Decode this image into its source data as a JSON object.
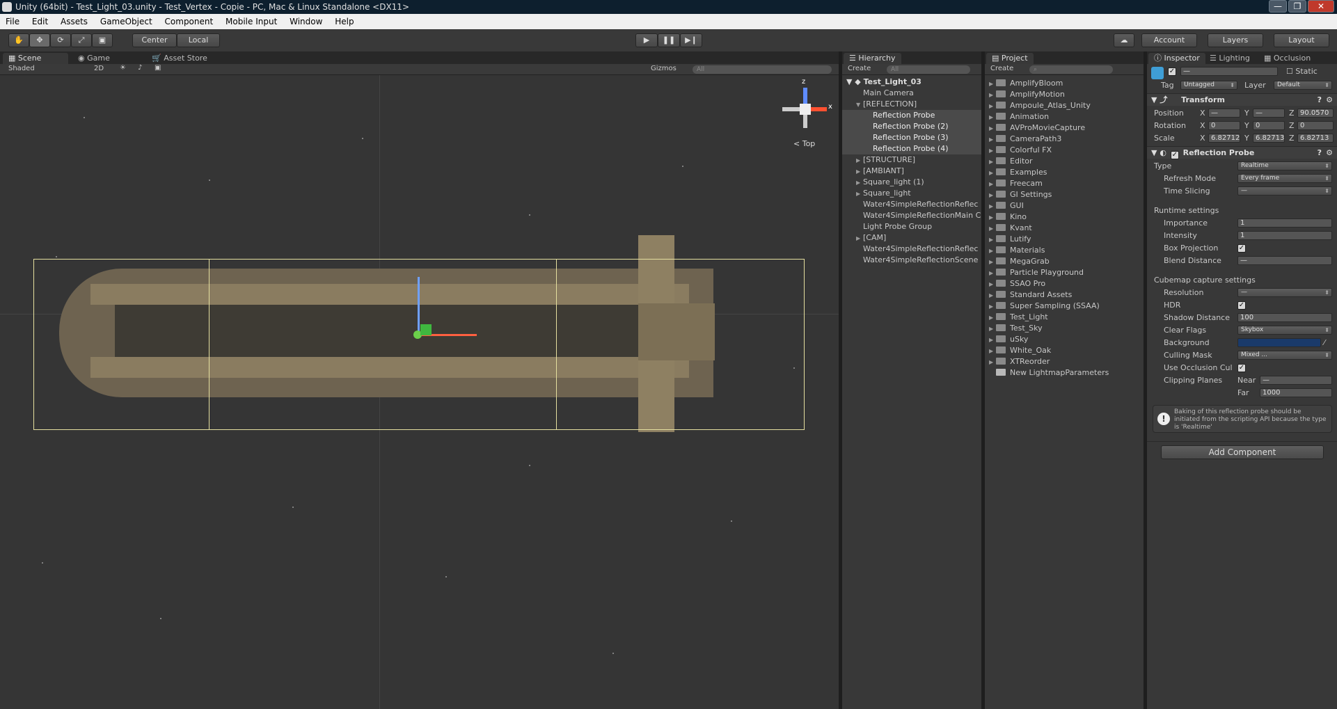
{
  "window": {
    "title": "Unity (64bit) - Test_Light_03.unity - Test_Vertex - Copie - PC, Mac & Linux Standalone <DX11>",
    "min": "—",
    "max": "❐",
    "close": "✕"
  },
  "menu": [
    "File",
    "Edit",
    "Assets",
    "GameObject",
    "Component",
    "Mobile Input",
    "Window",
    "Help"
  ],
  "toolbar": {
    "pivot": "Center",
    "space": "Local",
    "account": "Account",
    "layers": "Layers",
    "layout": "Layout"
  },
  "scene": {
    "tabs": {
      "scene": "Scene",
      "game": "Game",
      "asset_store": "Asset Store"
    },
    "shading": "Shaded",
    "mode2d": "2D",
    "gizmos": "Gizmos",
    "search_placeholder": "All",
    "view_label": "Top",
    "axis_x": "x",
    "axis_z": "z"
  },
  "hierarchy": {
    "tab": "Hierarchy",
    "create": "Create",
    "search_placeholder": "All",
    "scene_name": "Test_Light_03",
    "items": [
      {
        "label": "Main Camera",
        "indent": 1,
        "arrow": "",
        "selected": false
      },
      {
        "label": "[REFLECTION]",
        "indent": 1,
        "arrow": "▼",
        "selected": false
      },
      {
        "label": "Reflection Probe",
        "indent": 2,
        "arrow": "",
        "selected": true
      },
      {
        "label": "Reflection Probe (2)",
        "indent": 2,
        "arrow": "",
        "selected": true
      },
      {
        "label": "Reflection Probe (3)",
        "indent": 2,
        "arrow": "",
        "selected": true
      },
      {
        "label": "Reflection Probe (4)",
        "indent": 2,
        "arrow": "",
        "selected": true
      },
      {
        "label": "[STRUCTURE]",
        "indent": 1,
        "arrow": "▶",
        "selected": false
      },
      {
        "label": "[AMBIANT]",
        "indent": 1,
        "arrow": "▶",
        "selected": false
      },
      {
        "label": "Square_light (1)",
        "indent": 1,
        "arrow": "▶",
        "selected": false
      },
      {
        "label": "Square_light",
        "indent": 1,
        "arrow": "▶",
        "selected": false
      },
      {
        "label": "Water4SimpleReflectionReflec",
        "indent": 1,
        "arrow": "",
        "selected": false
      },
      {
        "label": "Water4SimpleReflectionMain C",
        "indent": 1,
        "arrow": "",
        "selected": false
      },
      {
        "label": "Light Probe Group",
        "indent": 1,
        "arrow": "",
        "selected": false
      },
      {
        "label": "[CAM]",
        "indent": 1,
        "arrow": "▶",
        "selected": false
      },
      {
        "label": "Water4SimpleReflectionReflec",
        "indent": 1,
        "arrow": "",
        "selected": false
      },
      {
        "label": "Water4SimpleReflectionScene",
        "indent": 1,
        "arrow": "",
        "selected": false
      }
    ]
  },
  "project": {
    "tab": "Project",
    "create": "Create",
    "items": [
      "AmplifyBloom",
      "AmplifyMotion",
      "Ampoule_Atlas_Unity",
      "Animation",
      "AVProMovieCapture",
      "CameraPath3",
      "Colorful FX",
      "Editor",
      "Examples",
      "Freecam",
      "GI Settings",
      "GUI",
      "Kino",
      "Kvant",
      "Lutify",
      "Materials",
      "MegaGrab",
      "Particle Playground",
      "SSAO Pro",
      "Standard Assets",
      "Super Sampling (SSAA)",
      "Test_Light",
      "Test_Sky",
      "uSky",
      "White_Oak",
      "XTReorder"
    ],
    "extra_item": "New LightmapParameters"
  },
  "inspector": {
    "tabs": {
      "inspector": "Inspector",
      "lighting": "Lighting",
      "occlusion": "Occlusion"
    },
    "name_value": "—",
    "static_label": "Static",
    "tag_label": "Tag",
    "tag_value": "Untagged",
    "layer_label": "Layer",
    "layer_value": "Default",
    "transform": {
      "title": "Transform",
      "position": {
        "label": "Position",
        "x": "—",
        "y": "—",
        "z": "90.0570"
      },
      "rotation": {
        "label": "Rotation",
        "x": "0",
        "y": "0",
        "z": "0"
      },
      "scale": {
        "label": "Scale",
        "x": "6.82712",
        "y": "6.82713",
        "z": "6.82713"
      },
      "x": "X",
      "y": "Y",
      "z": "Z"
    },
    "probe": {
      "title": "Reflection Probe",
      "type_label": "Type",
      "type_value": "Realtime",
      "refresh_label": "Refresh Mode",
      "refresh_value": "Every frame",
      "slicing_label": "Time Slicing",
      "slicing_value": "—",
      "runtime_header": "Runtime settings",
      "importance_label": "Importance",
      "importance_value": "1",
      "intensity_label": "Intensity",
      "intensity_value": "1",
      "boxproj_label": "Box Projection",
      "blend_label": "Blend Distance",
      "blend_value": "—",
      "cubemap_header": "Cubemap capture settings",
      "resolution_label": "Resolution",
      "resolution_value": "—",
      "hdr_label": "HDR",
      "shadow_label": "Shadow Distance",
      "shadow_value": "100",
      "clear_label": "Clear Flags",
      "clear_value": "Skybox",
      "background_label": "Background",
      "background_color": "#1a3a6a",
      "culling_label": "Culling Mask",
      "culling_value": "Mixed ...",
      "occlusion_label": "Use Occlusion Cul",
      "clipping_label": "Clipping Planes",
      "near_label": "Near",
      "near_value": "—",
      "far_label": "Far",
      "far_value": "1000",
      "info": "Baking of this reflection probe should be initiated from the scripting API because the type is 'Realtime'"
    },
    "add_component": "Add Component"
  }
}
